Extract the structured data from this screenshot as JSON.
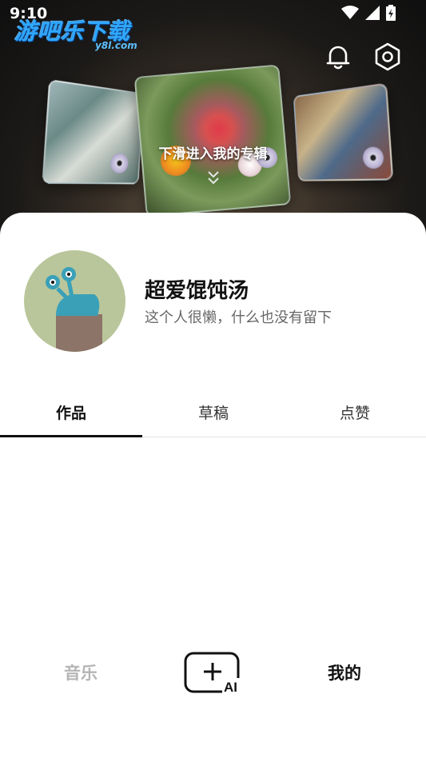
{
  "status_bar": {
    "time": "9:10"
  },
  "watermark": {
    "brand": "游吧乐下载",
    "site": "y8l.com"
  },
  "header": {
    "swipe_hint": "下滑进入我的专辑",
    "icons": [
      "bell-icon",
      "settings-icon"
    ]
  },
  "profile": {
    "username": "超爱馄饨汤",
    "bio": "这个人很懒，什么也没有留下"
  },
  "tabs": [
    {
      "label": "作品",
      "active": true
    },
    {
      "label": "草稿",
      "active": false
    },
    {
      "label": "点赞",
      "active": false
    }
  ],
  "bottom_nav": {
    "music_label": "音乐",
    "create_ai_label": "AI",
    "mine_label": "我的"
  },
  "colors": {
    "accent": "#111111",
    "inactive": "#b5b5b5",
    "avatar_bg": "#b9c69b"
  }
}
